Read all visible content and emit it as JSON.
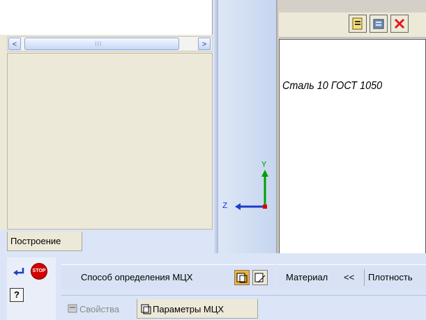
{
  "tree_panel": {
    "scroll_left": "<",
    "scroll_right": ">",
    "scroll_thumb_grip": "III",
    "tab_label": "Построение"
  },
  "viewport": {
    "axis_y": "Y",
    "axis_z": "Z"
  },
  "document": {
    "text": "Сталь 10  ГОСТ 1050"
  },
  "toolbar": {
    "mcx_method_label": "Способ определения МЦХ",
    "material_label": "Материал",
    "material_arrow": "<<",
    "density_label": "Плотность",
    "help_glyph": "?",
    "stop_label": "STOP"
  },
  "bottom_tabs": [
    {
      "label": "Свойства"
    },
    {
      "label": "Параметры МЦХ"
    }
  ]
}
